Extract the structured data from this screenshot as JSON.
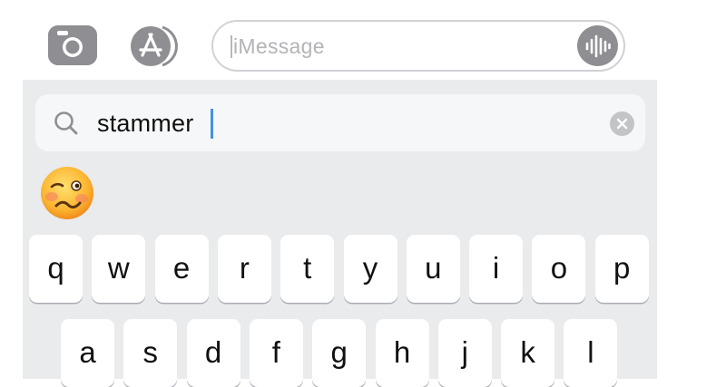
{
  "compose": {
    "camera_icon": "camera-icon",
    "appstore_icon": "app-store-icon",
    "message_field": {
      "placeholder": "iMessage",
      "value": ""
    },
    "audio_icon": "waveform-icon"
  },
  "emoji_search": {
    "query": "stammer",
    "search_icon": "magnifying-glass-icon",
    "clear_icon": "clear-x-icon",
    "results": [
      {
        "emoji": "woozy-face",
        "glyph": "🥴"
      }
    ]
  },
  "keyboard": {
    "row1": [
      "q",
      "w",
      "e",
      "r",
      "t",
      "y",
      "u",
      "i",
      "o",
      "p"
    ],
    "row2": [
      "a",
      "s",
      "d",
      "f",
      "g",
      "h",
      "j",
      "k",
      "l"
    ]
  },
  "colors": {
    "keyboard_bg": "#e9ebed",
    "key_bg": "#ffffff",
    "icon_gray": "#8e8e93",
    "caret_blue": "#4a90e2"
  }
}
